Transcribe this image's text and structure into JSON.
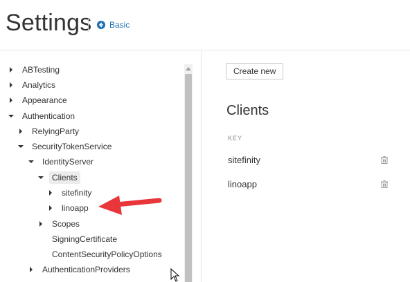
{
  "header": {
    "title": "Settings",
    "basic_link": "Basic"
  },
  "tree": [
    {
      "label": "ABTesting",
      "state": "collapsed"
    },
    {
      "label": "Analytics",
      "state": "collapsed"
    },
    {
      "label": "Appearance",
      "state": "collapsed"
    },
    {
      "label": "Authentication",
      "state": "expanded"
    },
    {
      "label": "RelyingParty",
      "state": "collapsed"
    },
    {
      "label": "SecurityTokenService",
      "state": "expanded"
    },
    {
      "label": "IdentityServer",
      "state": "expanded"
    },
    {
      "label": "Clients",
      "state": "expanded",
      "selected": true
    },
    {
      "label": "sitefinity",
      "state": "collapsed"
    },
    {
      "label": "linoapp",
      "state": "collapsed"
    },
    {
      "label": "Scopes",
      "state": "collapsed"
    },
    {
      "label": "SigningCertificate",
      "state": "leaf"
    },
    {
      "label": "ContentSecurityPolicyOptions",
      "state": "leaf"
    },
    {
      "label": "AuthenticationProviders",
      "state": "collapsed"
    }
  ],
  "content": {
    "create_button": "Create new",
    "title": "Clients",
    "key_header": "KEY",
    "rows": [
      {
        "name": "sitefinity"
      },
      {
        "name": "linoapp"
      }
    ]
  },
  "colors": {
    "link": "#1f6fb2",
    "arrow": "#e8363a",
    "scroll_thumb": "#c1c1c1"
  }
}
